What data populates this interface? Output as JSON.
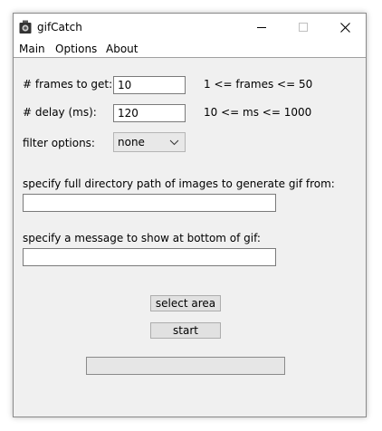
{
  "window": {
    "title": "gifCatch",
    "controls": {
      "minimize": "minimize",
      "maximize": "maximize",
      "close": "close"
    }
  },
  "menu": {
    "items": [
      "Main",
      "Options",
      "About"
    ]
  },
  "frames": {
    "label": "# frames to get:",
    "value": "10",
    "hint": "1 <= frames <= 50"
  },
  "delay": {
    "label": "# delay (ms):",
    "value": "120",
    "hint": "10 <= ms <= 1000"
  },
  "filter": {
    "label": "filter options:",
    "selected": "none"
  },
  "directory": {
    "label": "specify full directory path of images to generate gif from:",
    "value": ""
  },
  "message": {
    "label": "specify a message to show at bottom of gif:",
    "value": ""
  },
  "buttons": {
    "select_area": "select area",
    "start": "start"
  },
  "progress": {
    "value": 0
  },
  "colors": {
    "window_bg": "#f0f0f0",
    "titlebar_bg": "#ffffff",
    "border": "#8a8a8a"
  }
}
